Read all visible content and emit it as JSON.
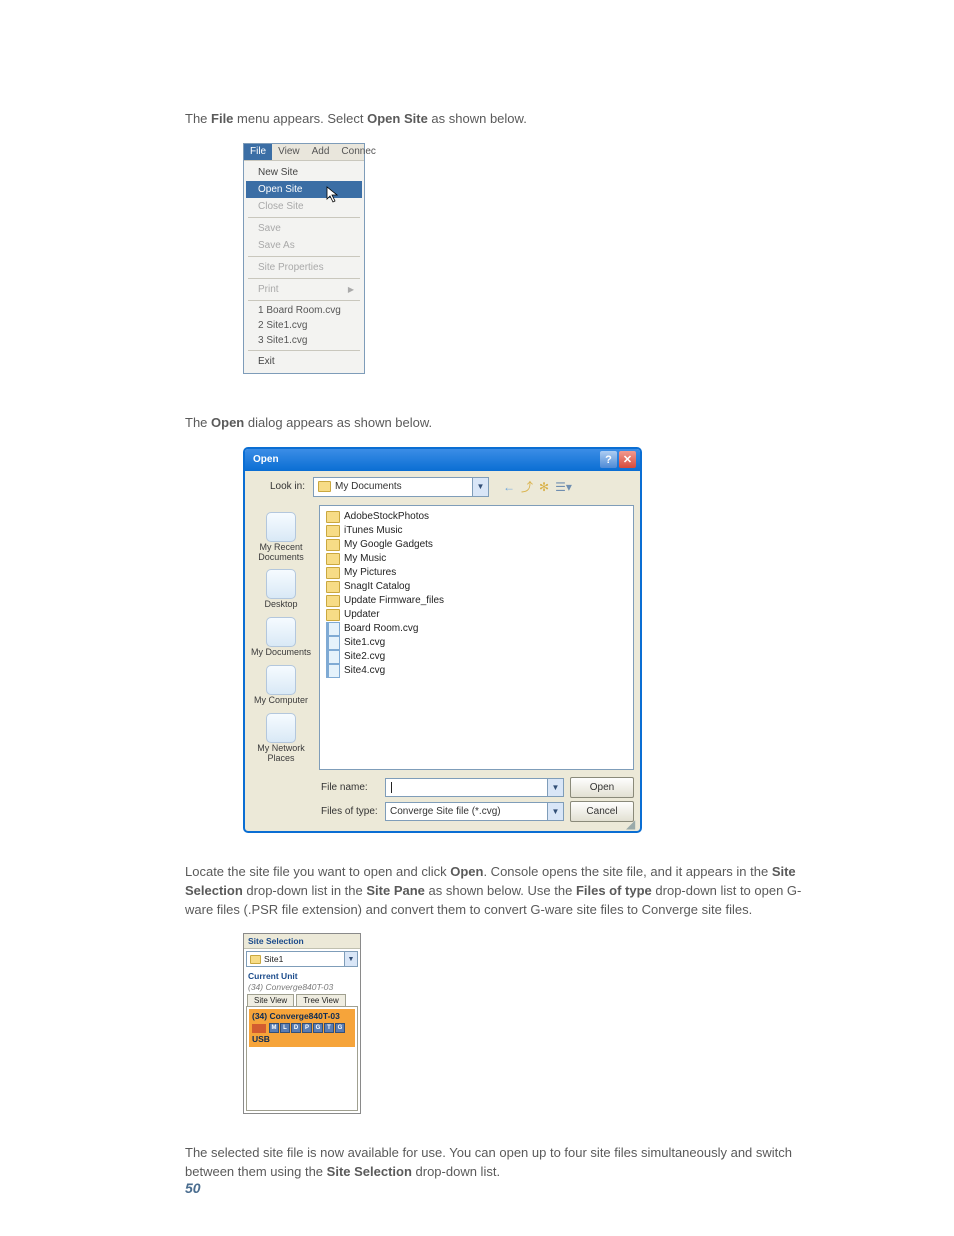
{
  "text": {
    "intro_a": "The ",
    "intro_b": " menu appears. Select ",
    "intro_c": " as shown below.",
    "file_word": "File",
    "open_site": "Open Site",
    "open_dialog_a": "The ",
    "open_word": "Open",
    "open_dialog_b": " dialog appears as shown below.",
    "para2_a": "Locate the site file you want to open and click ",
    "para2_b": ". Console opens the site file, and it appears in the ",
    "site_selection": "Site Selection",
    "para2_c": " drop-down list in the ",
    "site_pane": "Site Pane",
    "para2_d": " as shown below. Use the ",
    "files_of_type": "Files of type",
    "para2_e": " drop-down list to open G-ware files (.PSR file extension) and convert them to convert G-ware site files to Converge site files.",
    "para3_a": "The selected site file is now available for use. You can open up to four site files simultaneously and switch between them using the ",
    "para3_b": " drop-down list."
  },
  "menu": {
    "bar": [
      "File",
      "View",
      "Add",
      "Connec"
    ],
    "items": [
      {
        "label": "New Site",
        "disabled": false
      },
      {
        "label": "Open Site",
        "highlight": true
      },
      {
        "label": "Close Site",
        "disabled": true
      }
    ],
    "group2": [
      {
        "label": "Save",
        "disabled": true
      },
      {
        "label": "Save As",
        "disabled": true
      }
    ],
    "group3": [
      {
        "label": "Site Properties",
        "disabled": true
      }
    ],
    "group4": [
      {
        "label": "Print",
        "disabled": true,
        "submenu": true
      }
    ],
    "recent": [
      "1  Board Room.cvg",
      "2  Site1.cvg",
      "3  Site1.cvg"
    ],
    "exit": "Exit"
  },
  "dialog": {
    "title": "Open",
    "lookin_label": "Look in:",
    "lookin_value": "My Documents",
    "places": [
      "My Recent Documents",
      "Desktop",
      "My Documents",
      "My Computer",
      "My Network Places"
    ],
    "folders": [
      "AdobeStockPhotos",
      "iTunes Music",
      "My Google Gadgets",
      "My Music",
      "My Pictures",
      "SnagIt Catalog",
      "Update Firmware_files",
      "Updater"
    ],
    "cvg_files": [
      "Board Room.cvg",
      "Site1.cvg",
      "Site2.cvg",
      "Site4.cvg"
    ],
    "filename_label": "File name:",
    "filetype_label": "Files of type:",
    "filetype_value": "Converge Site file (*.cvg)",
    "open_btn": "Open",
    "cancel_btn": "Cancel"
  },
  "sitepane": {
    "title": "Site Selection",
    "selected": "Site1",
    "current_unit_label": "Current Unit",
    "current_unit": "(34) Converge840T-03",
    "tabs": [
      "Site View",
      "Tree View"
    ],
    "device": "(34) Converge840T-03",
    "badge_letters": [
      "M",
      "L",
      "D",
      "P",
      "G",
      "T",
      "G"
    ],
    "usb": "USB"
  },
  "page_number": "50"
}
